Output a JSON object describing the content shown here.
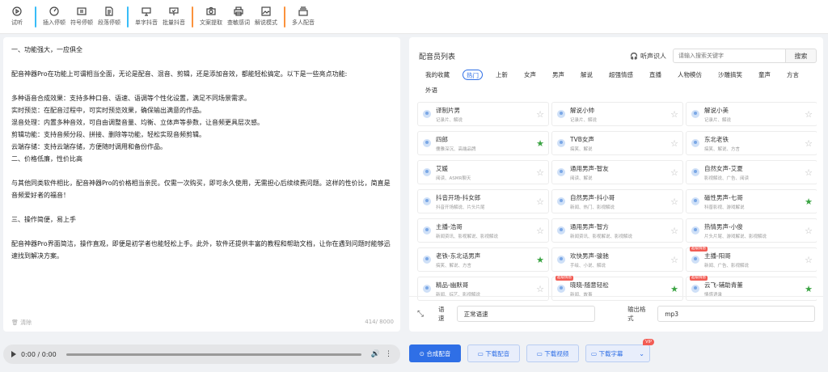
{
  "toolbar": {
    "items": [
      {
        "label": "试听",
        "icon": "play-circle-icon"
      },
      {
        "label": "插入停顿",
        "icon": "gauge-icon"
      },
      {
        "label": "符号停顿",
        "icon": "pause-box-icon"
      },
      {
        "label": "段落停顿",
        "icon": "document-icon"
      },
      {
        "label": "单字抖音",
        "icon": "board-icon"
      },
      {
        "label": "批量抖音",
        "icon": "board-check-icon"
      },
      {
        "label": "文案提取",
        "icon": "camera-icon"
      },
      {
        "label": "查敏感词",
        "icon": "printer-icon"
      },
      {
        "label": "解说模式",
        "icon": "image-icon"
      },
      {
        "label": "多人配音",
        "icon": "stack-icon"
      }
    ]
  },
  "editor": {
    "paragraphs": [
      "一、功能强大，一应俱全",
      "",
      "配音神器Pro在功能上可谓相当全面，无论是配音、混音、剪辑，还是添加音效，都能轻松搞定。以下是一些亮点功能:",
      "",
      "多种语音合成效果：支持多种口音、语速、语调等个性化设置，满足不同场景需求。",
      "实时预览：在配音过程中，可实时预览效果，确保输出满意的作品。",
      "混音处理：内置多种音效，可自由调整音量、均衡、立体声等参数，让音频更具层次感。",
      "剪辑功能：支持音频分段、拼接、删除等功能，轻松实现音频剪辑。",
      "云端存储：支持云端存储，方便随时调用和备份作品。",
      "二、价格低廉，性价比高",
      "",
      "与其他同类软件相比，配音神器Pro的价格相当亲民。仅需一次购买，即可永久使用，无需担心后续续费问题。这样的性价比，简直是音频爱好者的福音！",
      "",
      "三、操作简便，易上手",
      "",
      "配音神器Pro界面简洁，操作直观，即便是初学者也能轻松上手。此外，软件还提供丰富的教程和帮助文档，让你在遇到问题时能够迅速找到解决方案。"
    ],
    "clear_label": "清除",
    "count": "414/ 8000"
  },
  "player": {
    "time": "0:00 / 0:00"
  },
  "voices": {
    "title": "配音员列表",
    "listen_label": "听声识人",
    "search_placeholder": "请输入搜索关键字",
    "search_button": "搜索",
    "categories": [
      "我的收藏",
      "热门",
      "上新",
      "女声",
      "男声",
      "解说",
      "超强情感",
      "直播",
      "人物模仿",
      "沙雕搞笑",
      "童声",
      "方言",
      "外语"
    ],
    "active_category": "热门",
    "cards": [
      {
        "name": "译制片男",
        "tags": "记录片、解说",
        "fav": false,
        "badge": ""
      },
      {
        "name": "解说小帅",
        "tags": "记录片、解说",
        "fav": false,
        "badge": ""
      },
      {
        "name": "解说小美",
        "tags": "记录片、解说",
        "fav": false,
        "badge": ""
      },
      {
        "name": "四郎",
        "tags": "儒雅深沉、高端品牌",
        "fav": true,
        "badge": ""
      },
      {
        "name": "TVB女声",
        "tags": "搞笑、解说",
        "fav": false,
        "badge": ""
      },
      {
        "name": "东北老铁",
        "tags": "搞笑、解说、方言",
        "fav": false,
        "badge": ""
      },
      {
        "name": "艾媛",
        "tags": "阅读、ASMR聊天",
        "fav": false,
        "badge": ""
      },
      {
        "name": "通用男声-智友",
        "tags": "阅读、解说",
        "fav": false,
        "badge": ""
      },
      {
        "name": "自然女声-艾夏",
        "tags": "影视解说、广告、阅读",
        "fav": false,
        "badge": ""
      },
      {
        "name": "抖音开场-抖女郎",
        "tags": "抖音开场解说、片头片尾",
        "fav": false,
        "badge": ""
      },
      {
        "name": "自然男声-抖小哥",
        "tags": "新闻、热门、影视解说",
        "fav": false,
        "badge": ""
      },
      {
        "name": "磁性男声-七哥",
        "tags": "科普影视、游戏解说",
        "fav": true,
        "badge": ""
      },
      {
        "name": "主播-浩哥",
        "tags": "新闻资讯、影视解说、影视解说",
        "fav": false,
        "badge": ""
      },
      {
        "name": "通用男声-智方",
        "tags": "新闻资讯、影视解说、影视解说",
        "fav": false,
        "badge": ""
      },
      {
        "name": "热情男声-小俊",
        "tags": "片头片尾、游戏解说、影视解说",
        "fav": false,
        "badge": ""
      },
      {
        "name": "老铁-东北话男声",
        "tags": "搞笑、解说、方言",
        "fav": true,
        "badge": ""
      },
      {
        "name": "欢快男声-骏驰",
        "tags": "手绘、小说、解说",
        "fav": false,
        "badge": ""
      },
      {
        "name": "主播-阳哥",
        "tags": "新闻、广告、影视解说",
        "fav": false,
        "badge": "超级情感"
      },
      {
        "name": "精品-幽默哥",
        "tags": "新闻、综艺、影视解说",
        "fav": false,
        "badge": ""
      },
      {
        "name": "晓晓-随意轻松",
        "tags": "新闻、故事",
        "fav": true,
        "badge": "超级情感"
      },
      {
        "name": "云飞-辅助青董",
        "tags": "情感语录",
        "fav": true,
        "badge": "超级情感"
      }
    ]
  },
  "settings": {
    "speed_label": "语速",
    "speed_value": "正常语速",
    "format_label": "输出格式",
    "format_value": "mp3"
  },
  "actions": {
    "synth": "合成配音",
    "download_audio": "下载配音",
    "download_video": "下载视频",
    "download_subtitle": "下载字幕",
    "vip": "VIP"
  },
  "colors": {
    "accent": "#2f6fe6",
    "fav_star": "#3aa342",
    "badge": "#f25c54"
  }
}
